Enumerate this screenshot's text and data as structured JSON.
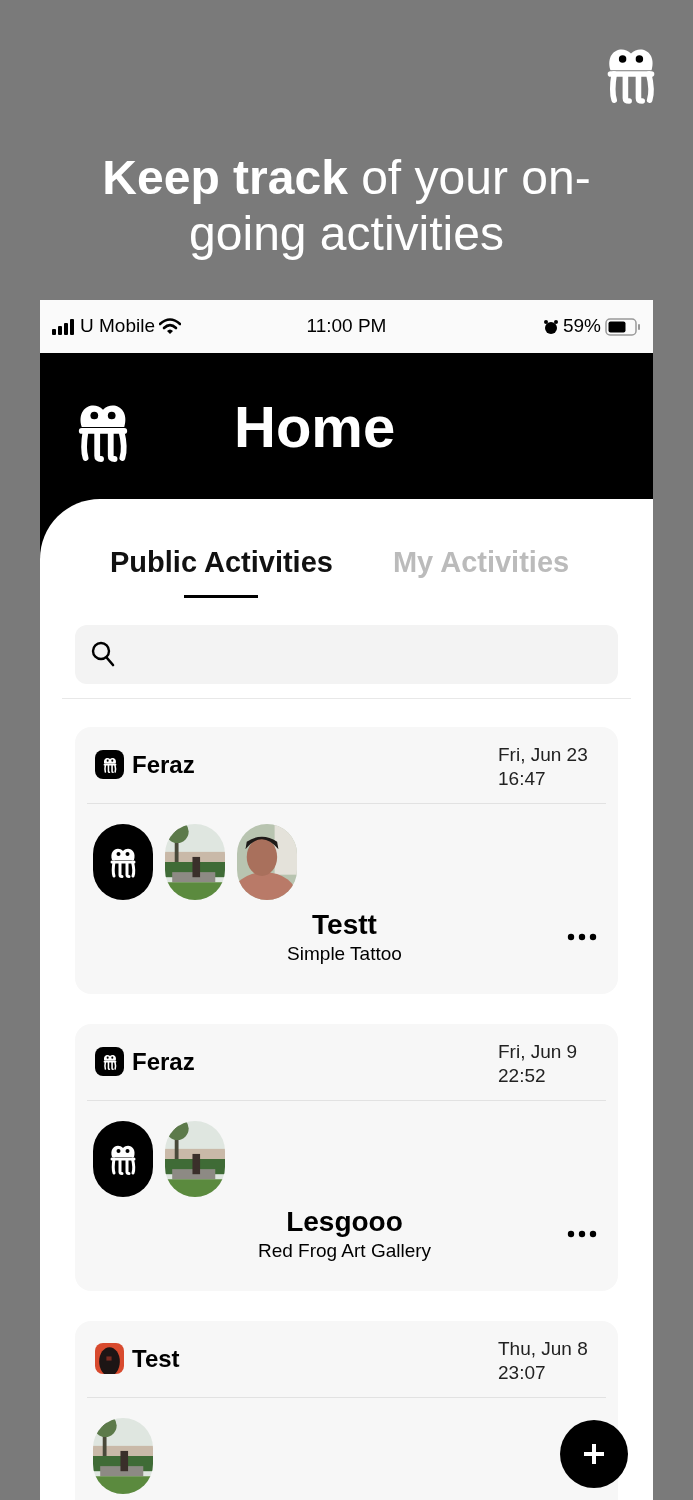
{
  "headline": "**Keep track** of your on-going activities",
  "status_bar": {
    "carrier": "U Mobile",
    "time": "11:00 PM",
    "battery": "59%"
  },
  "header": {
    "title": "Home"
  },
  "tabs": [
    {
      "label": "Public Activities",
      "selected": true
    },
    {
      "label": "My Activities",
      "selected": false
    }
  ],
  "activities": [
    {
      "author": "Feraz",
      "author_avatar": {
        "kind": "logo"
      },
      "date": "Fri, Jun 23",
      "time": "16:47",
      "participants": [
        {
          "kind": "logo"
        },
        {
          "kind": "picture"
        },
        {
          "kind": "picture"
        }
      ],
      "title": "Testt",
      "subtitle": "Simple Tattoo"
    },
    {
      "author": "Feraz",
      "author_avatar": {
        "kind": "logo"
      },
      "date": "Fri, Jun 9",
      "time": "22:52",
      "participants": [
        {
          "kind": "logo"
        },
        {
          "kind": "picture"
        }
      ],
      "title": "Lesgooo",
      "subtitle": "Red Frog Art Gallery"
    },
    {
      "author": "Test",
      "author_avatar": {
        "kind": "picture"
      },
      "date": "Thu, Jun 8",
      "time": "23:07",
      "participants": [
        {
          "kind": "picture"
        }
      ]
    }
  ]
}
